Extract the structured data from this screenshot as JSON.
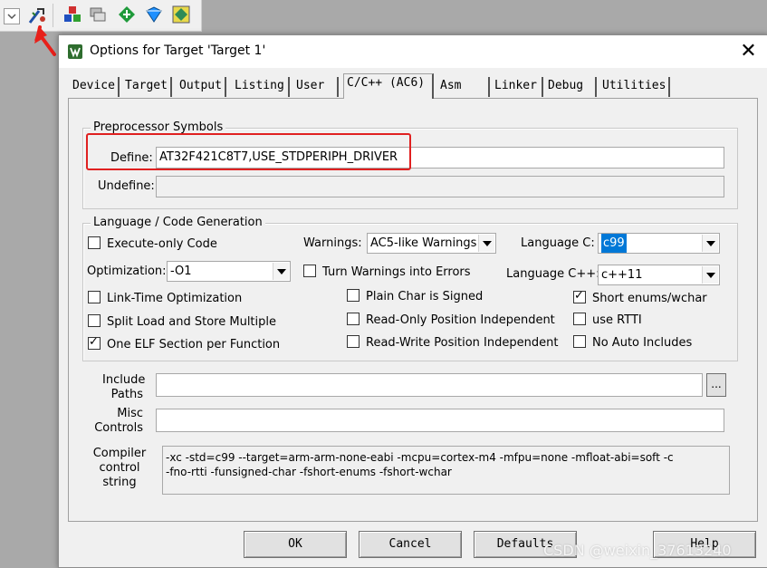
{
  "dialog": {
    "title": "Options for Target 'Target 1'",
    "close_glyph": "✕"
  },
  "tabs": [
    {
      "label": "Device"
    },
    {
      "label": "Target"
    },
    {
      "label": "Output"
    },
    {
      "label": "Listing"
    },
    {
      "label": "User"
    },
    {
      "label": "C/C++ (AC6)"
    },
    {
      "label": "Asm"
    },
    {
      "label": "Linker"
    },
    {
      "label": "Debug"
    },
    {
      "label": "Utilities"
    }
  ],
  "active_tab": "C/C++ (AC6)",
  "preprocessor": {
    "group_title": "Preprocessor Symbols",
    "define_label": "Define:",
    "define_value": "AT32F421C8T7,USE_STDPERIPH_DRIVER",
    "undefine_label": "Undefine:",
    "undefine_value": ""
  },
  "language": {
    "group_title": "Language / Code Generation",
    "execute_only": {
      "label": "Execute-only Code",
      "checked": false
    },
    "optimization_label": "Optimization:",
    "optimization_value": "-O1",
    "link_time": {
      "label": "Link-Time Optimization",
      "checked": false
    },
    "split_load": {
      "label": "Split Load and Store Multiple",
      "checked": false
    },
    "one_elf": {
      "label": "One ELF Section per Function",
      "checked": true
    },
    "warnings_label": "Warnings:",
    "warnings_value": "AC5-like Warnings",
    "turn_warnings": {
      "label": "Turn Warnings into Errors",
      "checked": false
    },
    "plain_char": {
      "label": "Plain Char is Signed",
      "checked": false
    },
    "ro_pi": {
      "label": "Read-Only Position Independent",
      "checked": false
    },
    "rw_pi": {
      "label": "Read-Write Position Independent",
      "checked": false
    },
    "language_c_label": "Language C:",
    "language_c_value": "c99",
    "language_cpp_label": "Language C++:",
    "language_cpp_value": "c++11",
    "short_enums": {
      "label": "Short enums/wchar",
      "checked": true
    },
    "use_rtti": {
      "label": "use RTTI",
      "checked": false
    },
    "no_auto_includes": {
      "label": "No Auto Includes",
      "checked": false
    }
  },
  "include": {
    "label_line1": "Include",
    "label_line2": "Paths",
    "value": "",
    "browse_label": "..."
  },
  "misc": {
    "label_line1": "Misc",
    "label_line2": "Controls",
    "value": ""
  },
  "compiler": {
    "label_line1": "Compiler",
    "label_line2": "control",
    "label_line3": "string",
    "line1": "-xc -std=c99 --target=arm-arm-none-eabi -mcpu=cortex-m4 -mfpu=none -mfloat-abi=soft -c",
    "line2": "-fno-rtti -funsigned-char -fshort-enums -fshort-wchar"
  },
  "buttons": {
    "ok": "OK",
    "cancel": "Cancel",
    "defaults": "Defaults",
    "help": "Help"
  },
  "watermark": "CSDN @weixin_37613240",
  "colors": {
    "highlight_box": "#e02020",
    "selection": "#0078d7",
    "annotation_arrow": "#e8201a"
  }
}
